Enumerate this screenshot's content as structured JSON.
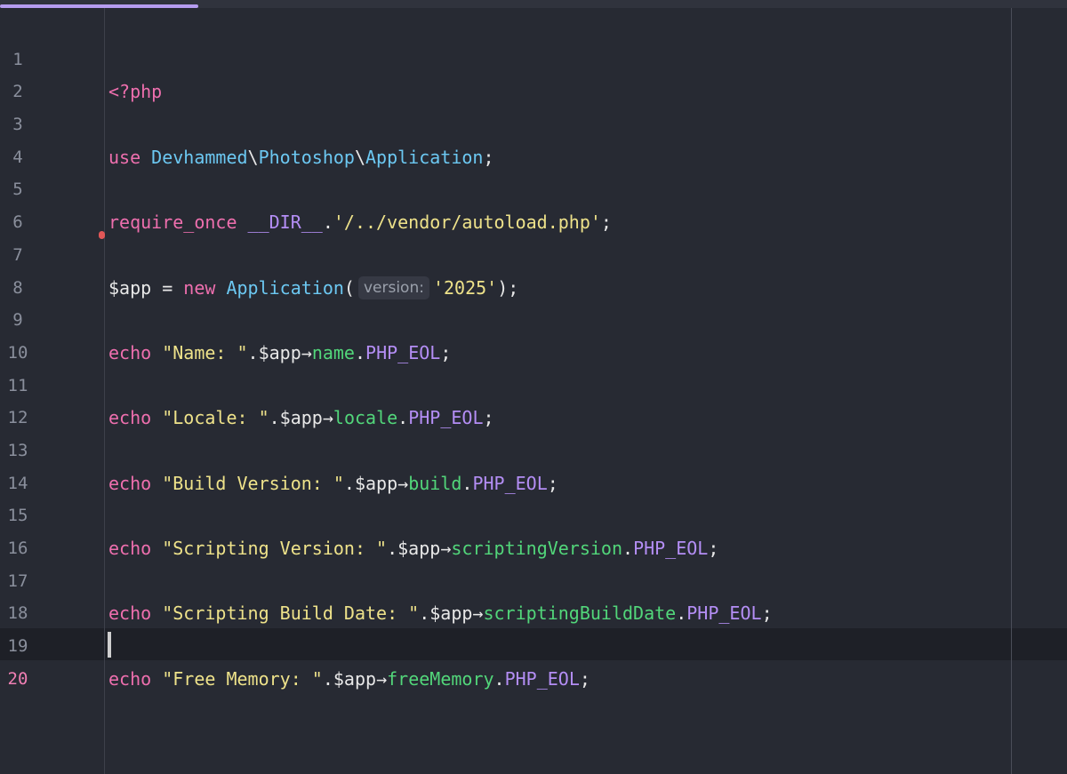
{
  "editor": {
    "language": "php",
    "active_line": "20",
    "colors": {
      "background": "#272a33",
      "keyword": "#ee6fae",
      "namespace": "#6cc8f2",
      "string": "#eee28a",
      "constant": "#b48ef5",
      "property": "#52d67a",
      "tab_indicator": "#b69cf0",
      "breakpoint": "#e25757"
    },
    "line_numbers": [
      "1",
      "2",
      "3",
      "4",
      "5",
      "6",
      "7",
      "8",
      "9",
      "10",
      "11",
      "12",
      "13",
      "14",
      "15",
      "16",
      "17",
      "18",
      "19",
      "20"
    ],
    "code": {
      "l1": {
        "open_tag": "<?php"
      },
      "l3": {
        "kw": "use",
        "ns1": "Devhammed",
        "sep1": "\\",
        "ns2": "Photoshop",
        "sep2": "\\",
        "ns3": "Application",
        "end": ";"
      },
      "l5": {
        "kw": "require_once",
        "dir": "__DIR__",
        "dot": ".",
        "str": "'/../vendor/autoload.php'",
        "end": ";"
      },
      "l7": {
        "var": "$app = ",
        "kw": "new",
        "cls": "Application",
        "paren": "(",
        "hint": "version:",
        "str": "'2025'",
        "end": ");"
      },
      "l9": {
        "kw": "echo",
        "str": "\"Name: \"",
        "dot": ".$app",
        "arrow": "→",
        "prop": "name",
        "dot2": ".",
        "const": "PHP_EOL",
        "end": ";"
      },
      "l11": {
        "kw": "echo",
        "str": "\"Locale: \"",
        "dot": ".$app",
        "arrow": "→",
        "prop": "locale",
        "dot2": ".",
        "const": "PHP_EOL",
        "end": ";"
      },
      "l13": {
        "kw": "echo",
        "str": "\"Build Version: \"",
        "dot": ".$app",
        "arrow": "→",
        "prop": "build",
        "dot2": ".",
        "const": "PHP_EOL",
        "end": ";"
      },
      "l15": {
        "kw": "echo",
        "str": "\"Scripting Version: \"",
        "dot": ".$app",
        "arrow": "→",
        "prop": "scriptingVersion",
        "dot2": ".",
        "const": "PHP_EOL",
        "end": ";"
      },
      "l17": {
        "kw": "echo",
        "str": "\"Scripting Build Date: \"",
        "dot": ".$app",
        "arrow": "→",
        "prop": "scriptingBuildDate",
        "dot2": ".",
        "const": "PHP_EOL",
        "end": ";"
      },
      "l19": {
        "kw": "echo",
        "str": "\"Free Memory: \"",
        "dot": ".$app",
        "arrow": "→",
        "prop": "freeMemory",
        "dot2": ".",
        "const": "PHP_EOL",
        "end": ";"
      }
    }
  }
}
